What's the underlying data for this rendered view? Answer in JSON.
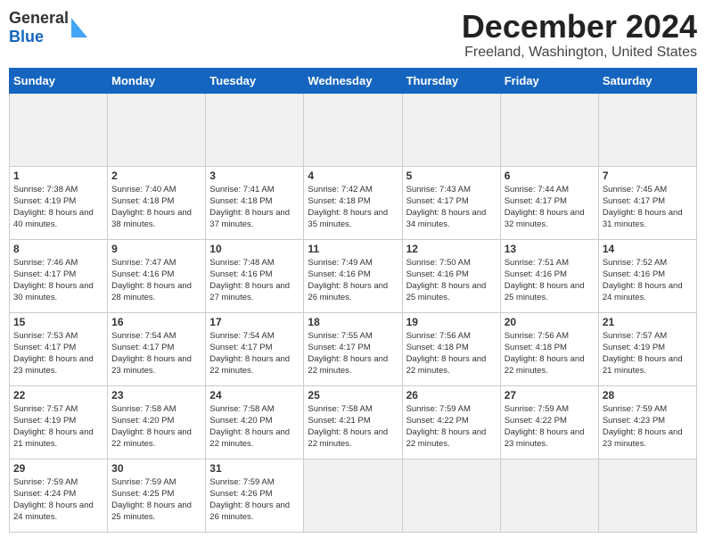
{
  "header": {
    "logo_line1": "General",
    "logo_line2": "Blue",
    "title": "December 2024",
    "subtitle": "Freeland, Washington, United States"
  },
  "weekdays": [
    "Sunday",
    "Monday",
    "Tuesday",
    "Wednesday",
    "Thursday",
    "Friday",
    "Saturday"
  ],
  "days": [
    {
      "num": "",
      "info": ""
    },
    {
      "num": "",
      "info": ""
    },
    {
      "num": "",
      "info": ""
    },
    {
      "num": "",
      "info": ""
    },
    {
      "num": "",
      "info": ""
    },
    {
      "num": "",
      "info": ""
    },
    {
      "num": "",
      "info": ""
    },
    {
      "num": "1",
      "info": "Sunrise: 7:38 AM\nSunset: 4:19 PM\nDaylight: 8 hours and 40 minutes."
    },
    {
      "num": "2",
      "info": "Sunrise: 7:40 AM\nSunset: 4:18 PM\nDaylight: 8 hours and 38 minutes."
    },
    {
      "num": "3",
      "info": "Sunrise: 7:41 AM\nSunset: 4:18 PM\nDaylight: 8 hours and 37 minutes."
    },
    {
      "num": "4",
      "info": "Sunrise: 7:42 AM\nSunset: 4:18 PM\nDaylight: 8 hours and 35 minutes."
    },
    {
      "num": "5",
      "info": "Sunrise: 7:43 AM\nSunset: 4:17 PM\nDaylight: 8 hours and 34 minutes."
    },
    {
      "num": "6",
      "info": "Sunrise: 7:44 AM\nSunset: 4:17 PM\nDaylight: 8 hours and 32 minutes."
    },
    {
      "num": "7",
      "info": "Sunrise: 7:45 AM\nSunset: 4:17 PM\nDaylight: 8 hours and 31 minutes."
    },
    {
      "num": "8",
      "info": "Sunrise: 7:46 AM\nSunset: 4:17 PM\nDaylight: 8 hours and 30 minutes."
    },
    {
      "num": "9",
      "info": "Sunrise: 7:47 AM\nSunset: 4:16 PM\nDaylight: 8 hours and 28 minutes."
    },
    {
      "num": "10",
      "info": "Sunrise: 7:48 AM\nSunset: 4:16 PM\nDaylight: 8 hours and 27 minutes."
    },
    {
      "num": "11",
      "info": "Sunrise: 7:49 AM\nSunset: 4:16 PM\nDaylight: 8 hours and 26 minutes."
    },
    {
      "num": "12",
      "info": "Sunrise: 7:50 AM\nSunset: 4:16 PM\nDaylight: 8 hours and 25 minutes."
    },
    {
      "num": "13",
      "info": "Sunrise: 7:51 AM\nSunset: 4:16 PM\nDaylight: 8 hours and 25 minutes."
    },
    {
      "num": "14",
      "info": "Sunrise: 7:52 AM\nSunset: 4:16 PM\nDaylight: 8 hours and 24 minutes."
    },
    {
      "num": "15",
      "info": "Sunrise: 7:53 AM\nSunset: 4:17 PM\nDaylight: 8 hours and 23 minutes."
    },
    {
      "num": "16",
      "info": "Sunrise: 7:54 AM\nSunset: 4:17 PM\nDaylight: 8 hours and 23 minutes."
    },
    {
      "num": "17",
      "info": "Sunrise: 7:54 AM\nSunset: 4:17 PM\nDaylight: 8 hours and 22 minutes."
    },
    {
      "num": "18",
      "info": "Sunrise: 7:55 AM\nSunset: 4:17 PM\nDaylight: 8 hours and 22 minutes."
    },
    {
      "num": "19",
      "info": "Sunrise: 7:56 AM\nSunset: 4:18 PM\nDaylight: 8 hours and 22 minutes."
    },
    {
      "num": "20",
      "info": "Sunrise: 7:56 AM\nSunset: 4:18 PM\nDaylight: 8 hours and 22 minutes."
    },
    {
      "num": "21",
      "info": "Sunrise: 7:57 AM\nSunset: 4:19 PM\nDaylight: 8 hours and 21 minutes."
    },
    {
      "num": "22",
      "info": "Sunrise: 7:57 AM\nSunset: 4:19 PM\nDaylight: 8 hours and 21 minutes."
    },
    {
      "num": "23",
      "info": "Sunrise: 7:58 AM\nSunset: 4:20 PM\nDaylight: 8 hours and 22 minutes."
    },
    {
      "num": "24",
      "info": "Sunrise: 7:58 AM\nSunset: 4:20 PM\nDaylight: 8 hours and 22 minutes."
    },
    {
      "num": "25",
      "info": "Sunrise: 7:58 AM\nSunset: 4:21 PM\nDaylight: 8 hours and 22 minutes."
    },
    {
      "num": "26",
      "info": "Sunrise: 7:59 AM\nSunset: 4:22 PM\nDaylight: 8 hours and 22 minutes."
    },
    {
      "num": "27",
      "info": "Sunrise: 7:59 AM\nSunset: 4:22 PM\nDaylight: 8 hours and 23 minutes."
    },
    {
      "num": "28",
      "info": "Sunrise: 7:59 AM\nSunset: 4:23 PM\nDaylight: 8 hours and 23 minutes."
    },
    {
      "num": "29",
      "info": "Sunrise: 7:59 AM\nSunset: 4:24 PM\nDaylight: 8 hours and 24 minutes."
    },
    {
      "num": "30",
      "info": "Sunrise: 7:59 AM\nSunset: 4:25 PM\nDaylight: 8 hours and 25 minutes."
    },
    {
      "num": "31",
      "info": "Sunrise: 7:59 AM\nSunset: 4:26 PM\nDaylight: 8 hours and 26 minutes."
    },
    {
      "num": "",
      "info": ""
    },
    {
      "num": "",
      "info": ""
    },
    {
      "num": "",
      "info": ""
    },
    {
      "num": "",
      "info": ""
    }
  ]
}
